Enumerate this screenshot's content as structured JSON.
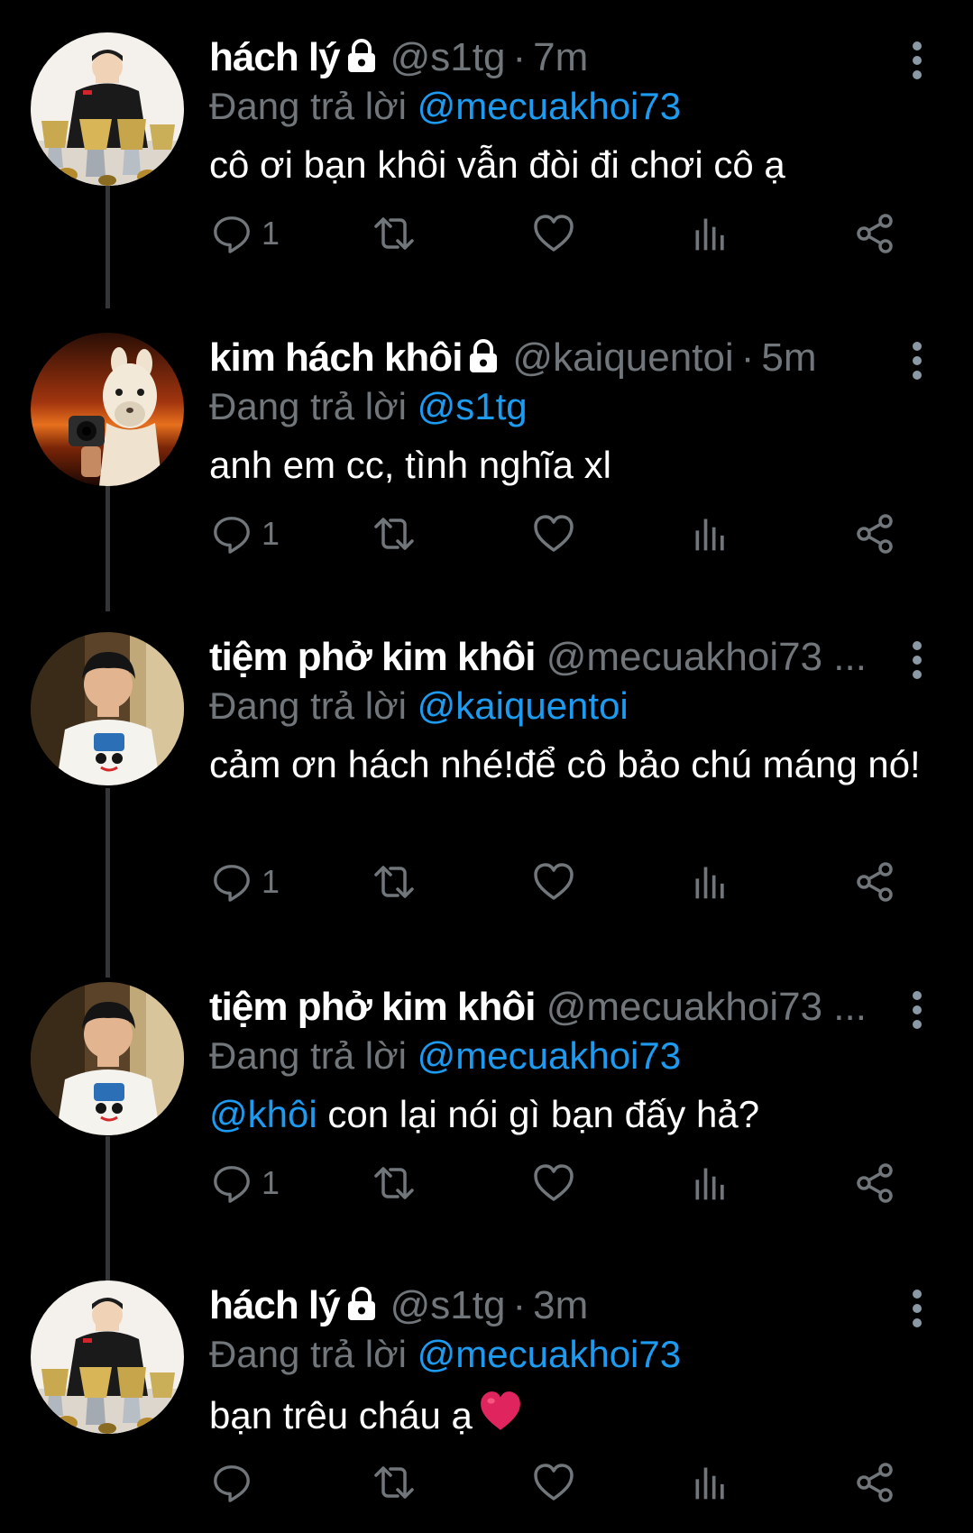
{
  "colors": {
    "background": "#000000",
    "text_primary": "#ffffff",
    "text_secondary": "#71767b",
    "accent_link": "#1d9bf0",
    "thread_line": "#333639",
    "heart_emoji": "#e0245e"
  },
  "tweets": [
    {
      "display_name": "hách lý",
      "protected": true,
      "handle": "@s1tg",
      "separator": "·",
      "time": "7m",
      "reply_prefix": "Đang trả lời",
      "reply_to": "@mecuakhoi73",
      "body": "cô ơi bạn khôi vẫn đòi đi chơi cô ạ",
      "reply_count": "1",
      "avatar": "avatar-trophies"
    },
    {
      "display_name": "kim hách khôi",
      "protected": true,
      "handle": "@kaiquentoi",
      "separator": "·",
      "time": "5m",
      "reply_prefix": "Đang trả lời",
      "reply_to": "@s1tg",
      "body": "anh em cc, tình nghĩa xl",
      "reply_count": "1",
      "avatar": "avatar-alpaca"
    },
    {
      "display_name": "tiệm phở kim khôi",
      "protected": false,
      "handle": "@mecuakhoi73 ...",
      "separator": "",
      "time": "",
      "reply_prefix": "Đang trả lời",
      "reply_to": "@kaiquentoi",
      "body": "cảm ơn hách nhé!để cô bảo chú máng nó!",
      "reply_count": "1",
      "avatar": "avatar-boy"
    },
    {
      "display_name": "tiệm phở kim khôi",
      "protected": false,
      "handle": "@mecuakhoi73 ...",
      "separator": "",
      "time": "",
      "reply_prefix": "Đang trả lời",
      "reply_to": "@mecuakhoi73",
      "body_mention": "@khôi",
      "body": " con lại nói gì bạn đấy hả?",
      "reply_count": "1",
      "avatar": "avatar-boy"
    },
    {
      "display_name": "hách lý",
      "protected": true,
      "handle": "@s1tg",
      "separator": "·",
      "time": "3m",
      "reply_prefix": "Đang trả lời",
      "reply_to": "@mecuakhoi73",
      "body": "bạn trêu cháu ạ",
      "body_emoji": "heart-emoji",
      "reply_count": "",
      "avatar": "avatar-trophies"
    }
  ],
  "action_icons": [
    "reply-icon",
    "retweet-icon",
    "like-icon",
    "views-icon",
    "share-icon"
  ]
}
